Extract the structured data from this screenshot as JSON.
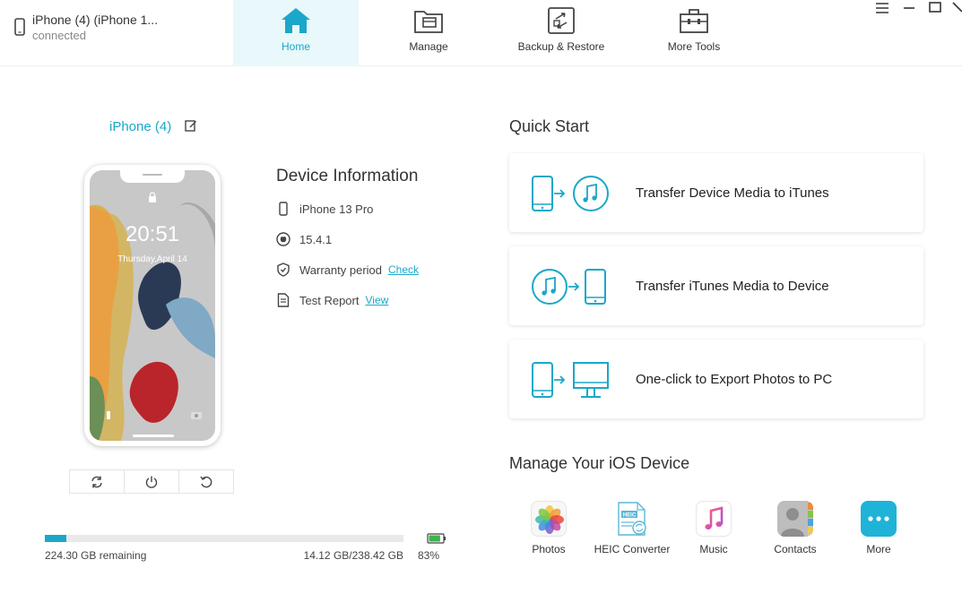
{
  "header": {
    "device_name": "iPhone (4) (iPhone 1...",
    "device_status": "connected",
    "tabs": [
      {
        "label": "Home",
        "icon": "home-icon",
        "active": true
      },
      {
        "label": "Manage",
        "icon": "folder-icon",
        "active": false
      },
      {
        "label": "Backup & Restore",
        "icon": "backup-restore-icon",
        "active": false
      },
      {
        "label": "More Tools",
        "icon": "toolbox-icon",
        "active": false
      }
    ],
    "window_controls": [
      "menu-icon",
      "minimize-icon",
      "maximize-icon",
      "close-icon"
    ]
  },
  "device": {
    "title": "iPhone (4)",
    "lock_time": "20:51",
    "lock_date": "Thursday,April 14",
    "controls": [
      "refresh-icon",
      "power-icon",
      "restart-icon"
    ]
  },
  "info": {
    "title": "Device Information",
    "model": "iPhone 13 Pro",
    "ios_version": "15.4.1",
    "warranty_label": "Warranty period",
    "warranty_link": "Check",
    "report_label": "Test Report",
    "report_link": "View"
  },
  "storage": {
    "remaining": "224.30 GB remaining",
    "used_total": "14.12 GB/238.42 GB",
    "used_fraction": 0.059,
    "battery": "83%",
    "battery_level": 0.83
  },
  "quick_start": {
    "title": "Quick Start",
    "items": [
      {
        "label": "Transfer Device Media to iTunes"
      },
      {
        "label": "Transfer iTunes Media to Device"
      },
      {
        "label": "One-click to Export Photos to PC"
      }
    ]
  },
  "manage": {
    "title": "Manage Your iOS Device",
    "apps": [
      {
        "label": "Photos",
        "icon": "photos-icon"
      },
      {
        "label": "HEIC Converter",
        "icon": "heic-converter-icon"
      },
      {
        "label": "Music",
        "icon": "music-icon"
      },
      {
        "label": "Contacts",
        "icon": "contacts-icon"
      },
      {
        "label": "More",
        "icon": "more-icon"
      }
    ]
  },
  "colors": {
    "accent": "#1aa7c9",
    "active_tab_bg": "#e8f8fb",
    "battery": "#3bb54a"
  }
}
